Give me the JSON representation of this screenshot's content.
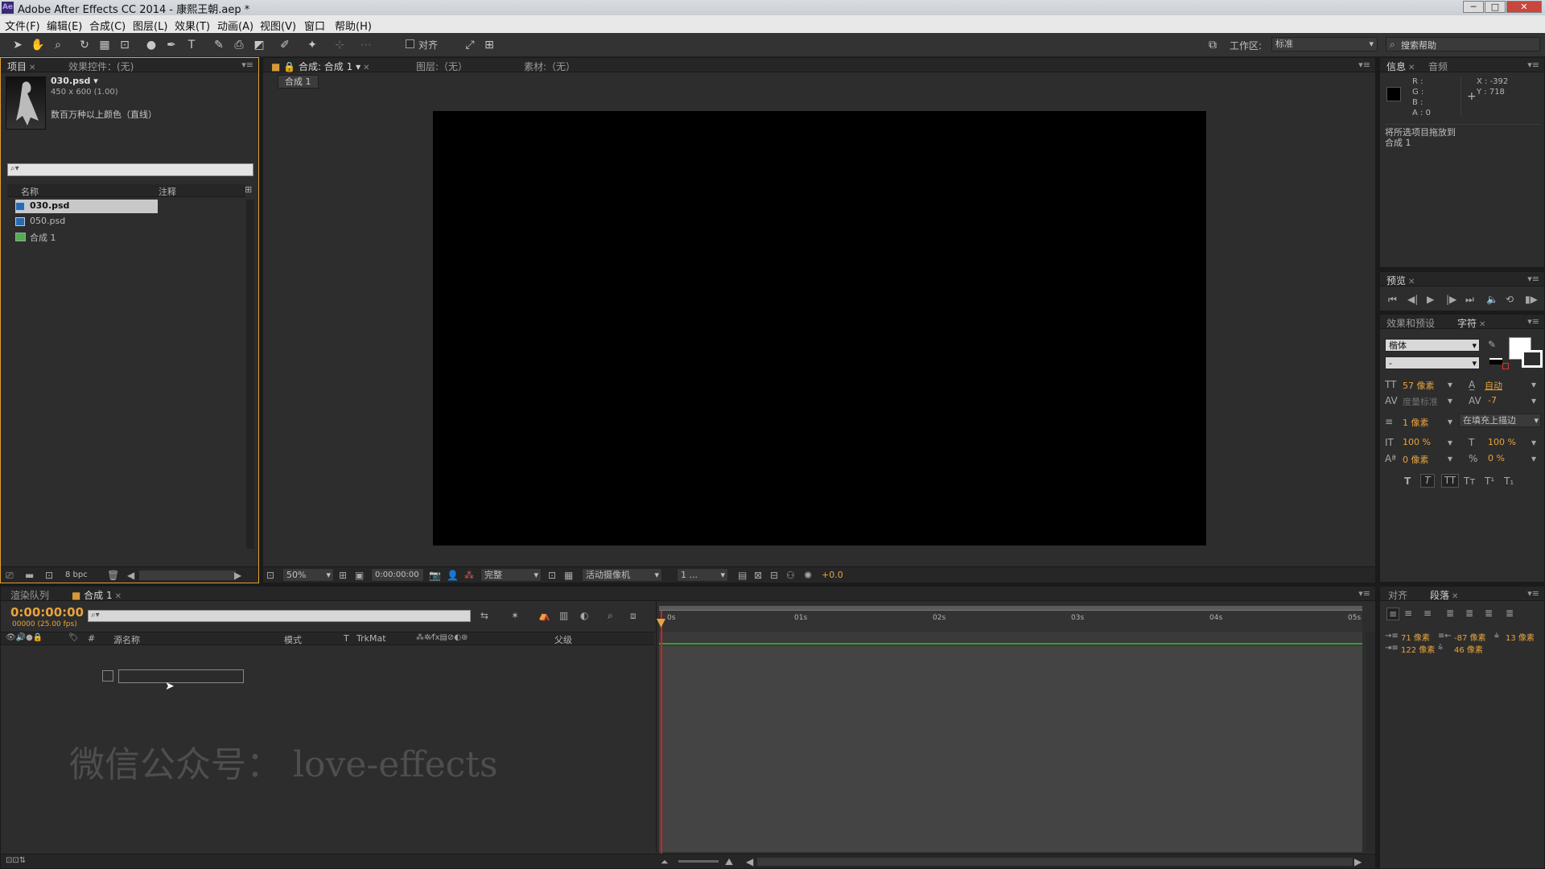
{
  "app": {
    "title": "Adobe After Effects CC 2014 - 康熙王朝.aep *",
    "logo": "Ae",
    "win_min": "─",
    "win_max": "□",
    "win_close": "✕"
  },
  "menu": [
    "文件(F)",
    "编辑(E)",
    "合成(C)",
    "图层(L)",
    "效果(T)",
    "动画(A)",
    "视图(V)",
    "窗口",
    "帮助(H)"
  ],
  "toolbar": {
    "align_label": "对齐",
    "workspace_label": "工作区:",
    "workspace_value": "标准",
    "search_placeholder": "搜索帮助"
  },
  "project": {
    "tab": "项目",
    "effects_tab": "效果控件：(无)",
    "file": "030.psd ▾",
    "dims": "450 x 600 (1.00)",
    "colors": "数百万种以上颜色（直线）",
    "col_name": "名称",
    "col_comment": "注释",
    "items": [
      {
        "name": "030.psd"
      },
      {
        "name": "050.psd"
      },
      {
        "name": "合成 1"
      }
    ],
    "bpc": "8 bpc"
  },
  "viewer": {
    "tab": "合成: 合成 1",
    "layer_tab": "图层:（无）",
    "footage_tab": "素材:（无）",
    "comp_chip": "合成 1",
    "zoom": "50%",
    "timecode": "0:00:00:00",
    "quality": "完整",
    "camera": "活动摄像机",
    "views": "1 ...",
    "exposure": "+0.0"
  },
  "info": {
    "tab": "信息",
    "audio_tab": "音频",
    "r": "R :",
    "g": "G :",
    "b": "B :",
    "a": "A : 0",
    "x": "X : -392",
    "y": "Y : 718",
    "message_line1": "将所选项目拖放到",
    "message_line2": "合成 1"
  },
  "preview": {
    "tab": "预览"
  },
  "character": {
    "effects_tab": "效果和预设",
    "tab": "字符",
    "font": "楷体",
    "style": "-",
    "size": "57 像素",
    "leading": "自动",
    "kerning": "度量标准",
    "tracking": "-7",
    "stroke_width": "1 像素",
    "stroke_mode": "在填充上描边",
    "v_scale": "100 %",
    "h_scale": "100 %",
    "baseline": "0 像素",
    "tsume": "0 %"
  },
  "bottom": {
    "render_tab": "渲染队列",
    "comp_tab": "合成 1",
    "timecode": "0:00:00:00",
    "fps": "00000 (25.00 fps)",
    "col_source": "源名称",
    "col_mode": "模式",
    "col_t": "T",
    "col_trkmat": "TrkMat",
    "col_parent": "父级",
    "ruler": [
      "0s",
      "01s",
      "02s",
      "03s",
      "04s",
      "05s"
    ]
  },
  "paragraph": {
    "align_tab": "对齐",
    "tab": "段落",
    "indent_left": "71 像素",
    "indent_right": "-87 像素",
    "space_before": "13 像素",
    "first_indent": "122 像素",
    "space_after": "46 像素"
  },
  "watermark": "微信公众号： love-effects",
  "colors": {
    "accent": "#e8a33c",
    "panel": "#2d2d2d",
    "timeline_bar": "#2ea12e",
    "playhead": "#d32020"
  }
}
